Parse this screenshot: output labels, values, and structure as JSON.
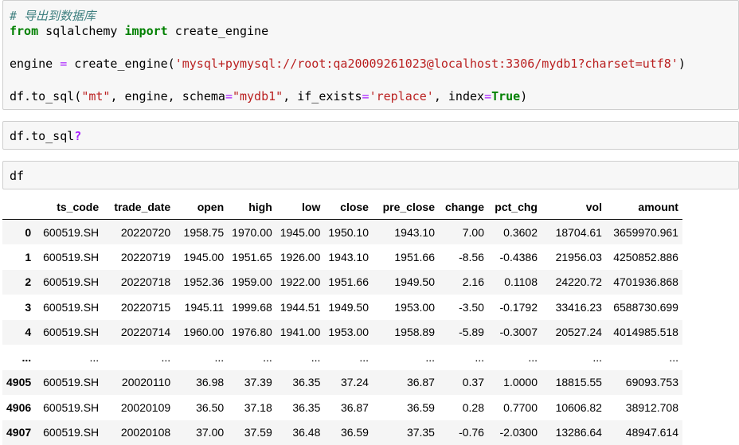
{
  "cell1": {
    "comment": "# 导出到数据库",
    "line2": {
      "kw_from": "from",
      "module": " sqlalchemy ",
      "kw_import": "import",
      "name": " create_engine"
    },
    "line4": {
      "a": "engine ",
      "eq": "=",
      "b": " create_engine(",
      "url": "'mysql+pymysql://root:qa20009261023@localhost:3306/mydb1?charset=utf8'",
      "c": ")"
    },
    "line6": {
      "a": "df.to_sql(",
      "s1": "\"mt\"",
      "b": ", engine, schema",
      "eq1": "=",
      "s2": "\"mydb1\"",
      "c": ", if_exists",
      "eq2": "=",
      "s3": "'replace'",
      "d": ", index",
      "eq3": "=",
      "kw_true": "True",
      "e": ")"
    }
  },
  "cell2": {
    "code": "df.to_sql",
    "qmark": "?"
  },
  "cell3": {
    "code": "df"
  },
  "table": {
    "columns": [
      "",
      "ts_code",
      "trade_date",
      "open",
      "high",
      "low",
      "close",
      "pre_close",
      "change",
      "pct_chg",
      "vol",
      "amount"
    ],
    "rows": [
      [
        "0",
        "600519.SH",
        "20220720",
        "1958.75",
        "1970.00",
        "1945.00",
        "1950.10",
        "1943.10",
        "7.00",
        "0.3602",
        "18704.61",
        "3659970.961"
      ],
      [
        "1",
        "600519.SH",
        "20220719",
        "1945.00",
        "1951.65",
        "1926.00",
        "1943.10",
        "1951.66",
        "-8.56",
        "-0.4386",
        "21956.03",
        "4250852.886"
      ],
      [
        "2",
        "600519.SH",
        "20220718",
        "1952.36",
        "1959.00",
        "1922.00",
        "1951.66",
        "1949.50",
        "2.16",
        "0.1108",
        "24220.72",
        "4701936.868"
      ],
      [
        "3",
        "600519.SH",
        "20220715",
        "1945.11",
        "1999.68",
        "1944.51",
        "1949.50",
        "1953.00",
        "-3.50",
        "-0.1792",
        "33416.23",
        "6588730.699"
      ],
      [
        "4",
        "600519.SH",
        "20220714",
        "1960.00",
        "1976.80",
        "1941.00",
        "1953.00",
        "1958.89",
        "-5.89",
        "-0.3007",
        "20527.24",
        "4014985.518"
      ],
      [
        "...",
        "...",
        "...",
        "...",
        "...",
        "...",
        "...",
        "...",
        "...",
        "...",
        "...",
        "..."
      ],
      [
        "4905",
        "600519.SH",
        "20020110",
        "36.98",
        "37.39",
        "36.35",
        "37.24",
        "36.87",
        "0.37",
        "1.0000",
        "18815.55",
        "69093.753"
      ],
      [
        "4906",
        "600519.SH",
        "20020109",
        "36.50",
        "37.18",
        "36.35",
        "36.87",
        "36.59",
        "0.28",
        "0.7700",
        "10606.82",
        "38912.708"
      ],
      [
        "4907",
        "600519.SH",
        "20020108",
        "37.00",
        "37.59",
        "36.48",
        "36.59",
        "37.35",
        "-0.76",
        "-2.0300",
        "13286.64",
        "48947.614"
      ]
    ]
  }
}
